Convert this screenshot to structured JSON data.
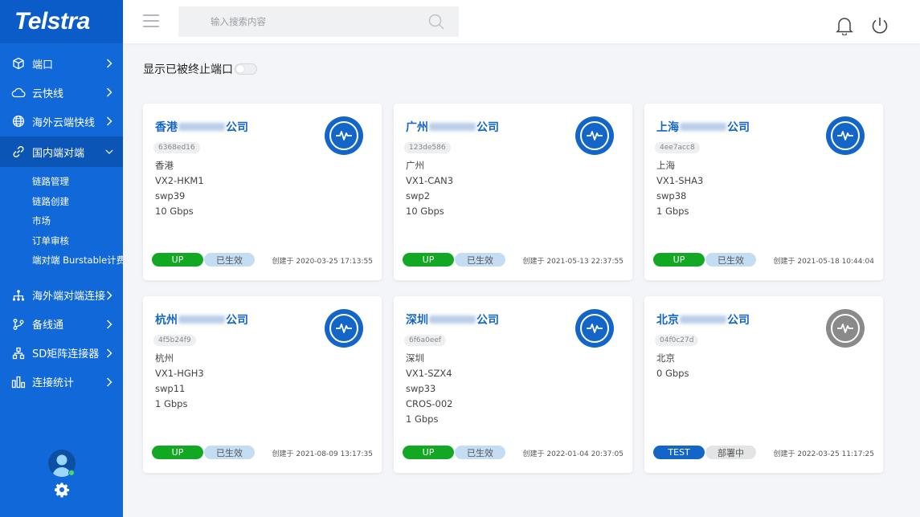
{
  "brand": {
    "name": "Telstra"
  },
  "sidebar": {
    "items": [
      {
        "label": "端口",
        "icon": "cube-icon"
      },
      {
        "label": "云快线",
        "icon": "cloud-icon"
      },
      {
        "label": "海外云端快线",
        "icon": "globe-icon"
      },
      {
        "label": "国内端对端",
        "icon": "link-icon",
        "active": true
      }
    ],
    "subitems": [
      "链路管理",
      "链路创建",
      "市场",
      "订单审核",
      "端对端 Burstable计费"
    ],
    "items2": [
      {
        "label": "海外端对端连接",
        "icon": "network-tree-icon"
      },
      {
        "label": "备线通",
        "icon": "branch-icon"
      },
      {
        "label": "SD矩阵连接器",
        "icon": "matrix-icon"
      },
      {
        "label": "连接统计",
        "icon": "bar-chart-icon"
      }
    ]
  },
  "header": {
    "search_placeholder": "输入搜索内容"
  },
  "toggle": {
    "label": "显示已被终止端口",
    "on": false
  },
  "cards": [
    {
      "title_prefix": "香港",
      "title_suffix": "公司",
      "id": "6368ed16",
      "lines": [
        "香港",
        "VX2-HKM1",
        "swp39",
        "10 Gbps"
      ],
      "status": "UP",
      "state": "已生效",
      "created": "创建于 2020-03-25 17:13:55",
      "icon": "activity-icon",
      "icon_color": "#1465c8"
    },
    {
      "title_prefix": "广州",
      "title_suffix": "公司",
      "id": "123de586",
      "lines": [
        "广州",
        "VX1-CAN3",
        "swp2",
        "10 Gbps"
      ],
      "status": "UP",
      "state": "已生效",
      "created": "创建于 2021-05-13 22:37:55",
      "icon": "activity-icon",
      "icon_color": "#1465c8"
    },
    {
      "title_prefix": "上海",
      "title_suffix": "公司",
      "id": "4ee7acc8",
      "lines": [
        "上海",
        "VX1-SHA3",
        "swp38",
        "1 Gbps"
      ],
      "status": "UP",
      "state": "已生效",
      "created": "创建于 2021-05-18 10:44:04",
      "icon": "activity-icon",
      "icon_color": "#1465c8"
    },
    {
      "title_prefix": "杭州",
      "title_suffix": "公司",
      "id": "4f5b24f9",
      "lines": [
        "杭州",
        "VX1-HGH3",
        "swp11",
        "1 Gbps"
      ],
      "status": "UP",
      "state": "已生效",
      "created": "创建于 2021-08-09 13:17:35",
      "icon": "activity-icon",
      "icon_color": "#1465c8"
    },
    {
      "title_prefix": "深圳",
      "title_suffix": "公司",
      "id": "6f6a0eef",
      "lines": [
        "深圳",
        "VX1-SZX4",
        "swp33",
        "CROS-002",
        "1 Gbps"
      ],
      "status": "UP",
      "state": "已生效",
      "created": "创建于 2022-01-04 20:37:05",
      "icon": "activity-icon",
      "icon_color": "#1465c8"
    },
    {
      "title_prefix": "北京",
      "title_suffix": "公司",
      "id": "04f0c27d",
      "lines": [
        "北京",
        "0 Gbps"
      ],
      "status": "TEST",
      "state": "部署中",
      "created": "创建于 2022-03-25 11:17:25",
      "icon": "activity-icon",
      "icon_color": "#8a8a8a"
    }
  ],
  "colors": {
    "sidebar": "#1168d8",
    "accent": "#1465c8",
    "up": "#12a823",
    "active_state": "#c4ddf2"
  }
}
